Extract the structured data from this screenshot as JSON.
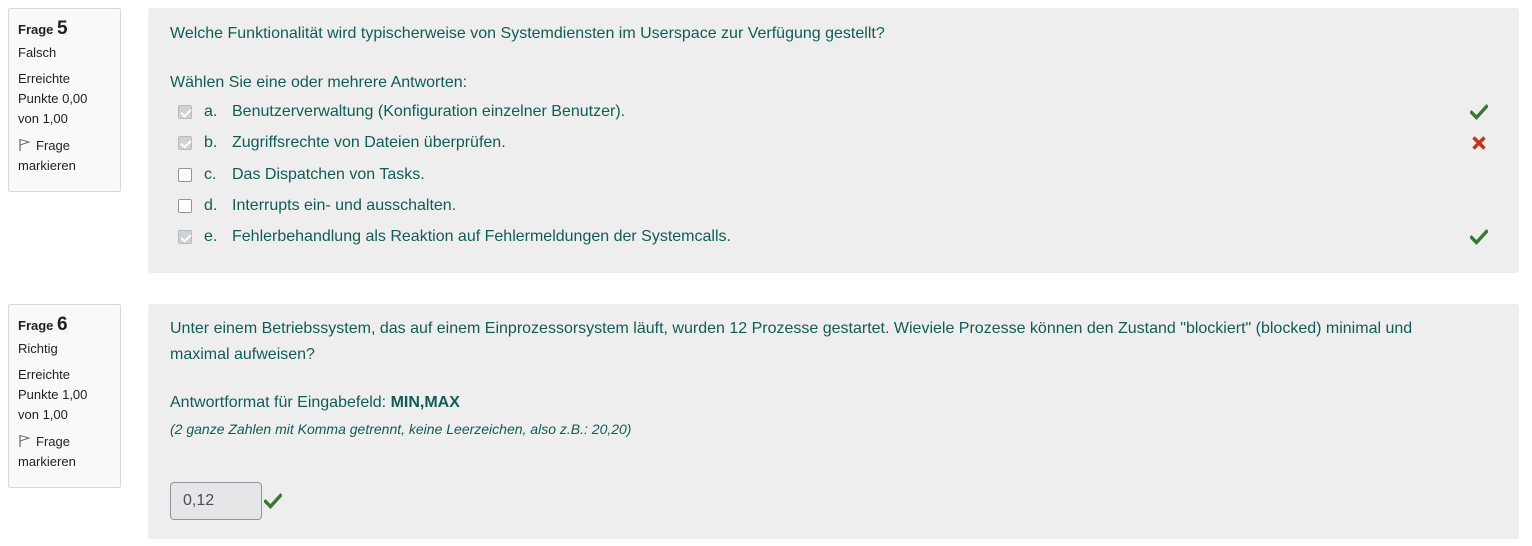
{
  "questions": [
    {
      "label": "Frage",
      "number": "5",
      "state": "Falsch",
      "grade": "Erreichte Punkte 0,00 von 1,00",
      "flag_label": "Frage markieren",
      "text": "Welche Funktionalität wird typischerweise von Systemdiensten im Userspace zur Verfügung gestellt?",
      "prompt": "Wählen Sie eine oder mehrere Antworten:",
      "answers": [
        {
          "letter": "a.",
          "text": "Benutzerverwaltung (Konfiguration einzelner Benutzer).",
          "checked": true,
          "feedback": "correct-check-icon"
        },
        {
          "letter": "b.",
          "text": "Zugriffsrechte von Dateien überprüfen.",
          "checked": true,
          "feedback": "incorrect-cross-icon"
        },
        {
          "letter": "c.",
          "text": "Das Dispatchen von Tasks.",
          "checked": false,
          "feedback": ""
        },
        {
          "letter": "d.",
          "text": "Interrupts ein- und ausschalten.",
          "checked": false,
          "feedback": ""
        },
        {
          "letter": "e.",
          "text": "Fehlerbehandlung als Reaktion auf Fehlermeldungen der Systemcalls.",
          "checked": true,
          "feedback": "correct-check-icon"
        }
      ]
    },
    {
      "label": "Frage",
      "number": "6",
      "state": "Richtig",
      "grade": "Erreichte Punkte 1,00 von 1,00",
      "flag_label": "Frage markieren",
      "text": "Unter einem Betriebssystem, das auf einem Einprozessorsystem läuft, wurden 12 Prozesse gestartet. Wieviele Prozesse können den Zustand \"blockiert\" (blocked) minimal und maximal aufweisen?",
      "format_prefix": "Antwortformat für Eingabefeld:",
      "format_value": "MIN,MAX",
      "hint": "(2 ganze Zahlen mit Komma getrennt, keine Leerzeichen, also z.B.: 20,20)",
      "answer_value": "0,12",
      "feedback": "correct-check-icon"
    }
  ],
  "colors": {
    "text_teal": "#0f5e55",
    "correct_green": "#357a32",
    "incorrect_red": "#ca3120",
    "panel_bg": "#eeeeee"
  }
}
